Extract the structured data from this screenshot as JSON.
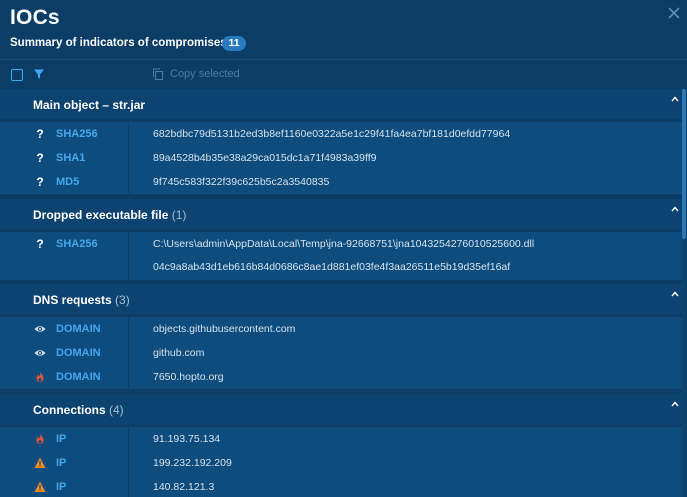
{
  "header": {
    "title": "IOCs",
    "subtitle": "Summary of indicators of compromises",
    "count": "11",
    "close_icon": "close-icon"
  },
  "toolbar": {
    "copy_label": "Copy selected"
  },
  "sections": [
    {
      "title": "Main object – str.jar",
      "count": "",
      "rows": [
        {
          "icon": "question-icon",
          "type": "SHA256",
          "value": "682bdbc79d5131b2ed3b8ef1160e0322a5e1c29f41fa4ea7bf181d0efdd77964"
        },
        {
          "icon": "question-icon",
          "type": "SHA1",
          "value": "89a4528b4b35e38a29ca015dc1a71f4983a39ff9"
        },
        {
          "icon": "question-icon",
          "type": "MD5",
          "value": "9f745c583f322f39c625b5c2a3540835"
        }
      ]
    },
    {
      "title": "Dropped executable file",
      "count": "(1)",
      "rows": [
        {
          "icon": "question-icon",
          "type": "SHA256",
          "value": "C:\\Users\\admin\\AppData\\Local\\Temp\\jna-92668751\\jna1043254276010525600.dll",
          "value2": "04c9a8ab43d1eb616b84d0686c8ae1d881ef03fe4f3aa26511e5b19d35ef16af"
        }
      ]
    },
    {
      "title": "DNS requests",
      "count": "(3)",
      "rows": [
        {
          "icon": "eye-icon",
          "type": "DOMAIN",
          "value": "objects.githubusercontent.com"
        },
        {
          "icon": "eye-icon",
          "type": "DOMAIN",
          "value": "github.com"
        },
        {
          "icon": "fire-icon",
          "type": "DOMAIN",
          "value": "7650.hopto.org"
        }
      ]
    },
    {
      "title": "Connections",
      "count": "(4)",
      "rows": [
        {
          "icon": "fire-icon",
          "type": "IP",
          "value": "91.193.75.134"
        },
        {
          "icon": "warning-icon",
          "type": "IP",
          "value": "199.232.192.209"
        },
        {
          "icon": "warning-icon",
          "type": "IP",
          "value": "140.82.121.3"
        }
      ]
    }
  ],
  "colors": {
    "background": "#0b3d66",
    "row": "#0e4c7d",
    "accent": "#45a8ee",
    "danger": "#e8573c",
    "warning": "#f08a24"
  }
}
